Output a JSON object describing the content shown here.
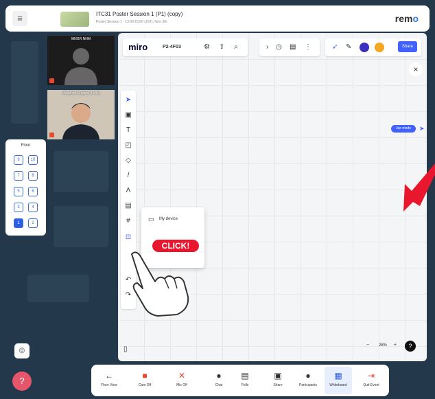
{
  "topbar": {
    "title": "ITC31 Poster Session 1 (P1) (copy)",
    "subtitle": "Poster Session 1 · 13:00-15:00 (JST), Nov. 8th",
    "logo_main": "rem",
    "logo_accent": "o"
  },
  "videos": [
    {
      "name": "MNGR NNM"
    },
    {
      "name": "Masahiro Sugiura (he/ls)"
    }
  ],
  "floor": {
    "label": "Floor",
    "buttons": [
      "9",
      "10",
      "7",
      "8",
      "5",
      "6",
      "3",
      "4",
      "1",
      "2"
    ],
    "active": "1"
  },
  "miro": {
    "logo": "miro",
    "board_name": "P2-4F03",
    "share_label": "Share",
    "cursor_label": "Joe mode",
    "upload_menu": {
      "item": "My device"
    },
    "zoom": "28%"
  },
  "overlay": {
    "click_label": "CLICK!"
  },
  "bottom_bar": {
    "items": [
      {
        "label": "Floor View",
        "icon": "←"
      },
      {
        "label": "Cam Off",
        "icon": "■"
      },
      {
        "label": "Mic Off",
        "icon": "✕"
      },
      {
        "label": "Chat",
        "icon": "●"
      },
      {
        "label": "Polls",
        "icon": "▤"
      },
      {
        "label": "Share",
        "icon": "▣"
      },
      {
        "label": "Participants",
        "icon": "●"
      },
      {
        "label": "Whiteboard",
        "icon": "▦"
      },
      {
        "label": "Quit Event",
        "icon": "⇥"
      }
    ]
  },
  "colors": {
    "accent": "#4262ff",
    "floor_active": "#2f5fe0",
    "click": "#e8172e",
    "arrow": "#e8172e"
  }
}
